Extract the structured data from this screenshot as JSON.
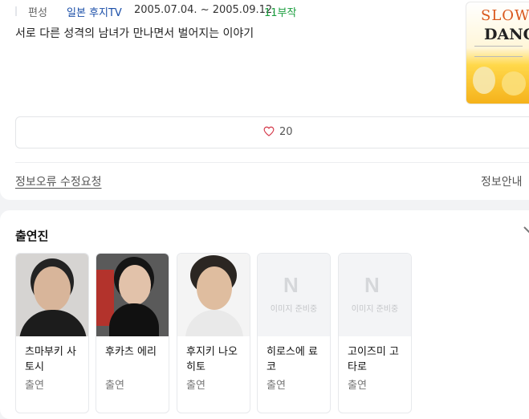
{
  "meta": {
    "label": "편성",
    "network": "일본 후지TV",
    "dates": "2005.07.04. ~ 2005.09.12.",
    "episodes": "11부작"
  },
  "description": "서로 다른 성격의 남녀가 만나면서 벌어지는 이야기",
  "poster": {
    "title_top": "SLOW",
    "title_bottom": "DANCE"
  },
  "like": {
    "count": "20",
    "icon": "heart-icon"
  },
  "footer": {
    "report": "정보오류 수정요청",
    "info": "정보안내"
  },
  "cast_section": {
    "title": "출연진",
    "members": [
      {
        "name": "츠마부키 사토시",
        "role": "출연"
      },
      {
        "name": "후카츠 에리",
        "role": "출연"
      },
      {
        "name": "후지키 나오히토",
        "role": "출연"
      },
      {
        "name": "히로스에 료코",
        "role": "출연",
        "placeholder": "이미지 준비중"
      },
      {
        "name": "고이즈미 고타로",
        "role": "출연",
        "placeholder": "이미지 준비중"
      }
    ]
  }
}
